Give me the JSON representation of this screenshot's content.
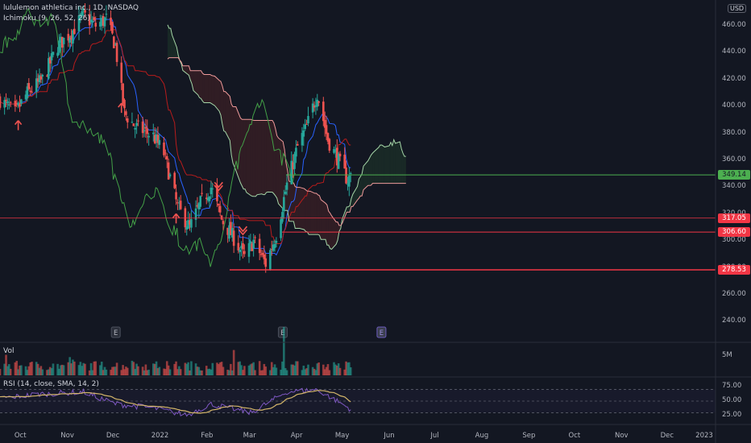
{
  "header": {
    "symbol_title": "lululemon athletica inc., 1D, NASDAQ",
    "indicator_ichimoku": "Ichimoku (9, 26, 52, 26)",
    "volume_label": "Vol",
    "rsi_label": "RSI (14, close, SMA, 14, 2)"
  },
  "currency": "USD",
  "colors": {
    "background": "#131722",
    "up": "#26a69a",
    "down": "#ef5350",
    "conversion_line": "#2962ff",
    "base_line": "#b71c1c",
    "lagging_span": "#43a047",
    "leading_a": "#a5d6a7",
    "leading_b": "#ef9a9a",
    "rsi_line": "#7e57c2",
    "rsi_ma": "#d4b66a",
    "hline_green": "#4caf50",
    "hline_red": "#f23645"
  },
  "price_levels": [
    {
      "value": "349.14",
      "color": "#4caf50",
      "text_color": "#131722"
    },
    {
      "value": "317.05",
      "color": "#f23645",
      "text_color": "#ffffff"
    },
    {
      "value": "306.60",
      "color": "#f23645",
      "text_color": "#ffffff"
    },
    {
      "value": "278.53",
      "color": "#f23645",
      "text_color": "#ffffff"
    }
  ],
  "price_axis": [
    "460.00",
    "440.00",
    "420.00",
    "400.00",
    "380.00",
    "360.00",
    "340.00",
    "320.00",
    "300.00",
    "280.00",
    "260.00",
    "240.00"
  ],
  "volume_axis": [
    "5M"
  ],
  "rsi_axis": [
    "75.00",
    "50.00",
    "25.00"
  ],
  "time_axis": [
    "Oct",
    "Nov",
    "Dec",
    "2022",
    "Feb",
    "Mar",
    "Apr",
    "May",
    "Jun",
    "Jul",
    "Aug",
    "Sep",
    "Oct",
    "Nov",
    "Dec",
    "2023"
  ],
  "earnings_markers": [
    "E",
    "E",
    "E"
  ],
  "chart_data": {
    "type": "candlestick",
    "title": "lululemon athletica inc., 1D, NASDAQ",
    "xlabel": "",
    "ylabel": "",
    "ylim": [
      225,
      475
    ],
    "x_range": [
      "2021-09-24",
      "2023-01-03"
    ],
    "grid": false,
    "anchors": [
      {
        "date": "2021-09-24",
        "close": 405
      },
      {
        "date": "2021-10-04",
        "close": 395
      },
      {
        "date": "2021-10-12",
        "close": 410
      },
      {
        "date": "2021-10-22",
        "close": 420
      },
      {
        "date": "2021-11-01",
        "close": 445
      },
      {
        "date": "2021-11-10",
        "close": 455
      },
      {
        "date": "2021-11-18",
        "close": 468
      },
      {
        "date": "2021-11-26",
        "close": 460
      },
      {
        "date": "2021-12-03",
        "close": 465
      },
      {
        "date": "2021-12-09",
        "close": 445
      },
      {
        "date": "2021-12-15",
        "close": 395
      },
      {
        "date": "2021-12-22",
        "close": 385
      },
      {
        "date": "2022-01-03",
        "close": 378
      },
      {
        "date": "2022-01-10",
        "close": 365
      },
      {
        "date": "2022-01-19",
        "close": 325
      },
      {
        "date": "2022-01-27",
        "close": 310
      },
      {
        "date": "2022-02-03",
        "close": 328
      },
      {
        "date": "2022-02-10",
        "close": 340
      },
      {
        "date": "2022-02-17",
        "close": 316
      },
      {
        "date": "2022-02-25",
        "close": 302
      },
      {
        "date": "2022-03-04",
        "close": 288
      },
      {
        "date": "2022-03-10",
        "close": 300
      },
      {
        "date": "2022-03-18",
        "close": 283
      },
      {
        "date": "2022-03-25",
        "close": 305
      },
      {
        "date": "2022-04-01",
        "close": 342
      },
      {
        "date": "2022-04-08",
        "close": 370
      },
      {
        "date": "2022-04-14",
        "close": 385
      },
      {
        "date": "2022-04-21",
        "close": 410
      },
      {
        "date": "2022-04-28",
        "close": 375
      },
      {
        "date": "2022-05-04",
        "close": 362
      },
      {
        "date": "2022-05-11",
        "close": 345
      },
      {
        "date": "2022-05-13",
        "close": 349
      }
    ],
    "horizontal_lines": [
      349.14,
      317.05,
      306.6,
      278.53
    ],
    "earnings_dates": [
      "2021-12-09",
      "2022-03-29",
      "2022-06-02"
    ],
    "arrows": [
      {
        "date": "2021-10-06",
        "direction": "up"
      },
      {
        "date": "2021-12-13",
        "direction": "up"
      },
      {
        "date": "2022-01-18",
        "direction": "up"
      },
      {
        "date": "2022-02-15",
        "direction": "down"
      },
      {
        "date": "2022-03-03",
        "direction": "down"
      }
    ],
    "volume": {
      "label": "Vol",
      "unit": "M",
      "spike": {
        "date": "2022-03-30",
        "value": 7.5
      },
      "typical": 1.5
    },
    "rsi": {
      "label": "RSI (14, close, SMA, 14, 2)",
      "bands": [
        70,
        50,
        30
      ],
      "ylim": [
        18,
        78
      ],
      "anchors": [
        {
          "date": "2021-09-24",
          "value": 55
        },
        {
          "date": "2021-10-20",
          "value": 62
        },
        {
          "date": "2021-11-18",
          "value": 66
        },
        {
          "date": "2021-12-09",
          "value": 45
        },
        {
          "date": "2022-01-03",
          "value": 38
        },
        {
          "date": "2022-01-25",
          "value": 26
        },
        {
          "date": "2022-02-10",
          "value": 45
        },
        {
          "date": "2022-03-08",
          "value": 30
        },
        {
          "date": "2022-04-01",
          "value": 66
        },
        {
          "date": "2022-04-21",
          "value": 70
        },
        {
          "date": "2022-05-04",
          "value": 50
        },
        {
          "date": "2022-05-13",
          "value": 36
        }
      ]
    }
  }
}
